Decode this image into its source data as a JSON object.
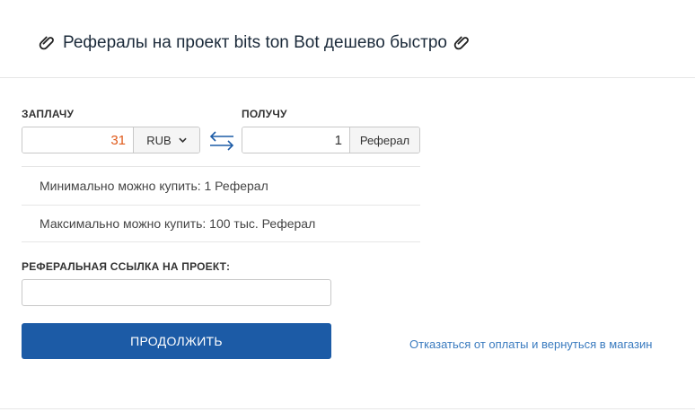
{
  "header": {
    "title": "Рефералы на проект bits ton Bot дешево быстро"
  },
  "form": {
    "pay_label": "ЗАПЛАЧУ",
    "pay_amount": "31",
    "currency": "RUB",
    "get_label": "ПОЛУЧУ",
    "get_amount": "1",
    "get_unit": "Реферал",
    "min_text": "Минимально можно купить: 1 Реферал",
    "max_text": "Максимально можно купить: 100 тыс. Реферал",
    "ref_label": "РЕФЕРАЛЬНАЯ ССЫЛКА НА ПРОЕКТ:",
    "ref_value": "",
    "continue_label": "ПРОДОЛЖИТЬ",
    "cancel_link": "Отказаться от оплаты и вернуться в магазин"
  },
  "colors": {
    "accent": "#1c5ba6",
    "link": "#3a7bbf",
    "pay_amount": "#e05a1a"
  },
  "icons": {
    "title_left": "paperclip-icon",
    "title_right": "paperclip-icon",
    "swap": "swap-arrows-icon",
    "dropdown": "chevron-down-icon"
  }
}
